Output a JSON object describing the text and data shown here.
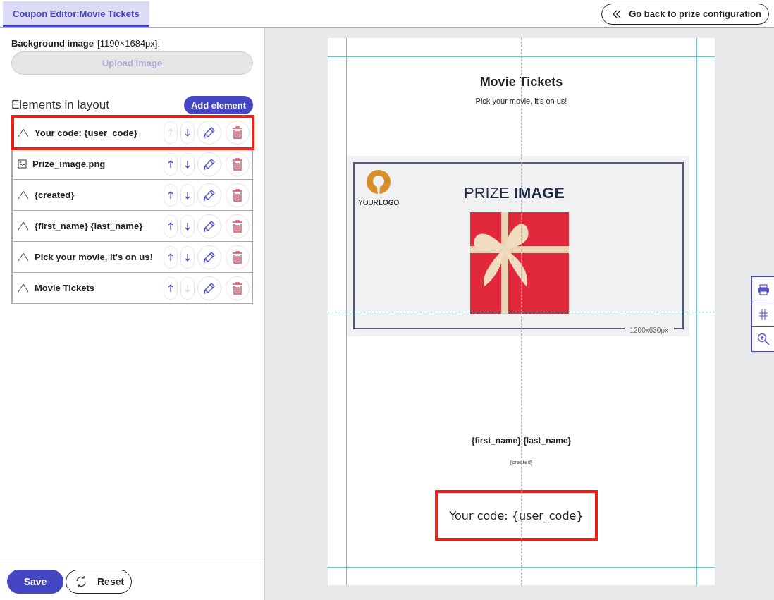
{
  "tab": {
    "label": "Coupon Editor:Movie Tickets",
    "selected": true
  },
  "back_button": "Go back to prize configuration",
  "background_image": {
    "label": "Background image",
    "size": "[1190×1684px]:",
    "upload_button": "Upload image",
    "disabled": true
  },
  "elements_heading": "Elements in layout",
  "add_button": "Add element",
  "elements": [
    {
      "kind": "text",
      "name": "Your code: {user_code}",
      "selected": true,
      "up_disabled": true,
      "down_disabled": false
    },
    {
      "kind": "image",
      "name": "Prize_image.png",
      "selected": false,
      "up_disabled": false,
      "down_disabled": false
    },
    {
      "kind": "text",
      "name": "{created}",
      "selected": false,
      "up_disabled": false,
      "down_disabled": false
    },
    {
      "kind": "text",
      "name": "{first_name} {last_name}",
      "selected": false,
      "up_disabled": false,
      "down_disabled": false
    },
    {
      "kind": "text",
      "name": "Pick your movie, it's on us!",
      "selected": false,
      "up_disabled": false,
      "down_disabled": false
    },
    {
      "kind": "text",
      "name": "Movie Tickets",
      "selected": false,
      "up_disabled": false,
      "down_disabled": true
    }
  ],
  "footer": {
    "save_button": "Save",
    "reset_button": "Reset"
  },
  "coupon": {
    "title": "Movie Tickets",
    "subtitle": "Pick your movie, it's on us!",
    "prize_image": {
      "heading": "PRIZE **IMAGE**",
      "logo": "YOUR**LOGO**",
      "size": "1200x630px"
    },
    "name_line": "{first_name} {last_name}",
    "created": "{created}",
    "code": "Your code: {user_code}",
    "code_selected": true
  }
}
